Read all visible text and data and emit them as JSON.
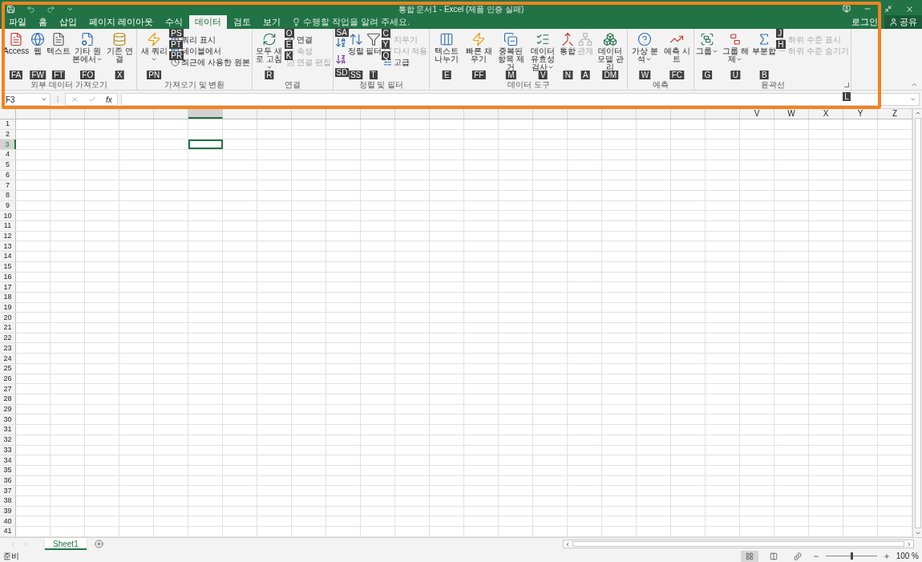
{
  "window": {
    "title": "통합 문서1 - Excel (제품 인증 실패)",
    "login": "로그인",
    "share": "공유"
  },
  "tabs": [
    {
      "label": "파일",
      "selected": false
    },
    {
      "label": "홈",
      "selected": false
    },
    {
      "label": "삽입",
      "selected": false
    },
    {
      "label": "페이지 레이아웃",
      "selected": false
    },
    {
      "label": "수식",
      "selected": false
    },
    {
      "label": "데이터",
      "selected": true
    },
    {
      "label": "검토",
      "selected": false
    },
    {
      "label": "보기",
      "selected": false
    }
  ],
  "tell_me": {
    "placeholder": "수행할 작업을 알려 주세요."
  },
  "ribbon_groups": [
    {
      "label": "외부 데이터 가져오기",
      "items": [
        {
          "kind": "large",
          "label": "Access",
          "keytip": "FA",
          "disabled": false,
          "dropdown": false
        },
        {
          "kind": "large",
          "label": "웹",
          "keytip": "FW",
          "disabled": false,
          "dropdown": false
        },
        {
          "kind": "large",
          "label": "텍스트",
          "keytip": "FT",
          "disabled": false,
          "dropdown": false
        },
        {
          "kind": "large",
          "label": "기타 원본에서",
          "keytip": "FO",
          "disabled": false,
          "dropdown": true
        },
        {
          "kind": "large",
          "label": "기존 연결",
          "keytip": "X",
          "disabled": false,
          "dropdown": false
        }
      ]
    },
    {
      "label": "가져오기 및 변환",
      "items": [
        {
          "kind": "large",
          "label": "새 쿼리",
          "keytip": "PN",
          "disabled": false,
          "dropdown": true
        },
        {
          "kind": "small",
          "label": "쿼리 표시",
          "keytip": "PS",
          "disabled": false,
          "dropdown": false
        },
        {
          "kind": "small",
          "label": "테이블에서",
          "keytip": "PT",
          "disabled": false,
          "dropdown": false
        },
        {
          "kind": "small",
          "label": "최근에 사용한 원본",
          "keytip": "PR",
          "disabled": false,
          "dropdown": false
        }
      ]
    },
    {
      "label": "연결",
      "items": [
        {
          "kind": "large",
          "label": "모두 새로 고침",
          "keytip": "R",
          "disabled": false,
          "dropdown": true
        },
        {
          "kind": "small",
          "label": "연결",
          "keytip": "O",
          "disabled": false,
          "dropdown": false
        },
        {
          "kind": "small",
          "label": "속성",
          "keytip": "E",
          "disabled": true,
          "dropdown": false
        },
        {
          "kind": "small",
          "label": "연결 편집",
          "keytip": "K",
          "disabled": true,
          "dropdown": false
        }
      ]
    },
    {
      "label": "정렬 및 필터",
      "items": [
        {
          "kind": "icon",
          "keytip": "SA",
          "disabled": false,
          "dropdown": false
        },
        {
          "kind": "icon",
          "keytip": "SD",
          "disabled": false,
          "dropdown": false
        },
        {
          "kind": "large",
          "label": "정렬",
          "keytip": "SS",
          "disabled": false,
          "dropdown": false
        },
        {
          "kind": "large",
          "label": "필터",
          "keytip": "T",
          "disabled": false,
          "dropdown": false
        },
        {
          "kind": "small",
          "label": "지우기",
          "keytip": "C",
          "disabled": true,
          "dropdown": false
        },
        {
          "kind": "small",
          "label": "다시 적용",
          "keytip": "Y",
          "disabled": true,
          "dropdown": false
        },
        {
          "kind": "small",
          "label": "고급",
          "keytip": "Q",
          "disabled": false,
          "dropdown": false
        }
      ]
    },
    {
      "label": "데이터 도구",
      "items": [
        {
          "kind": "large",
          "label": "텍스트 나누기",
          "keytip": "E",
          "disabled": false,
          "dropdown": false
        },
        {
          "kind": "large",
          "label": "빠른 채우기",
          "keytip": "FF",
          "disabled": false,
          "dropdown": false
        },
        {
          "kind": "large",
          "label": "중복된 항목 제거",
          "keytip": "M",
          "disabled": false,
          "dropdown": false
        },
        {
          "kind": "large",
          "label": "데이터 유효성 검사",
          "keytip": "V",
          "disabled": false,
          "dropdown": true
        },
        {
          "kind": "large",
          "label": "통합",
          "keytip": "N",
          "disabled": false,
          "dropdown": false
        },
        {
          "kind": "large",
          "label": "관계",
          "keytip": "A",
          "disabled": true,
          "dropdown": false
        },
        {
          "kind": "large",
          "label": "데이터 모델 관리",
          "keytip": "DM",
          "disabled": false,
          "dropdown": false
        }
      ]
    },
    {
      "label": "예측",
      "items": [
        {
          "kind": "large",
          "label": "가상 분석",
          "keytip": "W",
          "disabled": false,
          "dropdown": true
        },
        {
          "kind": "large",
          "label": "예측 시트",
          "keytip": "FC",
          "disabled": false,
          "dropdown": false
        }
      ]
    },
    {
      "label": "윤곽선",
      "launcher_keytip": "L",
      "items": [
        {
          "kind": "large",
          "label": "그룹",
          "keytip": "G",
          "disabled": false,
          "dropdown": true
        },
        {
          "kind": "large",
          "label": "그룹 해제",
          "keytip": "U",
          "disabled": false,
          "dropdown": true
        },
        {
          "kind": "large",
          "label": "부분합",
          "keytip": "B",
          "disabled": false,
          "dropdown": false
        },
        {
          "kind": "small",
          "label": "하위 수준 표시",
          "keytip": "J",
          "disabled": true,
          "dropdown": false
        },
        {
          "kind": "small",
          "label": "하위 수준 숨기기",
          "keytip": "H",
          "disabled": true,
          "dropdown": false
        }
      ]
    }
  ],
  "formula_bar": {
    "name_box": "F3",
    "function_label": "fx"
  },
  "sheet": {
    "covered_columns": [
      {
        "selected": false
      },
      {
        "selected": false
      },
      {
        "selected": false
      },
      {
        "selected": false
      },
      {
        "selected": false
      },
      {
        "selected": true
      },
      {
        "selected": false
      },
      {
        "selected": false
      },
      {
        "selected": false
      },
      {
        "selected": false
      },
      {
        "selected": false
      },
      {
        "selected": false
      },
      {
        "selected": false
      },
      {
        "selected": false
      },
      {
        "selected": false
      },
      {
        "selected": false
      },
      {
        "selected": false
      },
      {
        "selected": false
      },
      {
        "selected": false
      },
      {
        "selected": false
      },
      {
        "selected": false
      }
    ],
    "columns": [
      {
        "label": "V",
        "selected": false
      },
      {
        "label": "W",
        "selected": false
      },
      {
        "label": "X",
        "selected": false
      },
      {
        "label": "Y",
        "selected": false
      },
      {
        "label": "Z",
        "selected": false
      }
    ],
    "rows": [
      {
        "label": "1",
        "selected": false
      },
      {
        "label": "2",
        "selected": false
      },
      {
        "label": "3",
        "selected": true
      },
      {
        "label": "4",
        "selected": false
      },
      {
        "label": "5",
        "selected": false
      },
      {
        "label": "6",
        "selected": false
      },
      {
        "label": "7",
        "selected": false
      },
      {
        "label": "8",
        "selected": false
      },
      {
        "label": "9",
        "selected": false
      },
      {
        "label": "10",
        "selected": false
      },
      {
        "label": "11",
        "selected": false
      },
      {
        "label": "12",
        "selected": false
      },
      {
        "label": "13",
        "selected": false
      },
      {
        "label": "14",
        "selected": false
      },
      {
        "label": "15",
        "selected": false
      },
      {
        "label": "16",
        "selected": false
      },
      {
        "label": "17",
        "selected": false
      },
      {
        "label": "18",
        "selected": false
      },
      {
        "label": "19",
        "selected": false
      },
      {
        "label": "20",
        "selected": false
      },
      {
        "label": "21",
        "selected": false
      },
      {
        "label": "22",
        "selected": false
      },
      {
        "label": "23",
        "selected": false
      },
      {
        "label": "24",
        "selected": false
      },
      {
        "label": "25",
        "selected": false
      },
      {
        "label": "26",
        "selected": false
      },
      {
        "label": "27",
        "selected": false
      },
      {
        "label": "28",
        "selected": false
      },
      {
        "label": "29",
        "selected": false
      },
      {
        "label": "30",
        "selected": false
      },
      {
        "label": "31",
        "selected": false
      },
      {
        "label": "32",
        "selected": false
      },
      {
        "label": "33",
        "selected": false
      },
      {
        "label": "34",
        "selected": false
      },
      {
        "label": "35",
        "selected": false
      },
      {
        "label": "36",
        "selected": false
      },
      {
        "label": "37",
        "selected": false
      },
      {
        "label": "38",
        "selected": false
      },
      {
        "label": "39",
        "selected": false
      },
      {
        "label": "40",
        "selected": false
      },
      {
        "label": "41",
        "selected": false
      }
    ]
  },
  "sheet_tabs": [
    {
      "label": "Sheet1",
      "selected": true
    }
  ],
  "status_bar": {
    "status": "준비",
    "views": [
      {
        "selected": true
      },
      {
        "selected": false
      },
      {
        "selected": false
      }
    ],
    "zoom": {
      "level": 0.5,
      "reading": "100 %"
    }
  }
}
